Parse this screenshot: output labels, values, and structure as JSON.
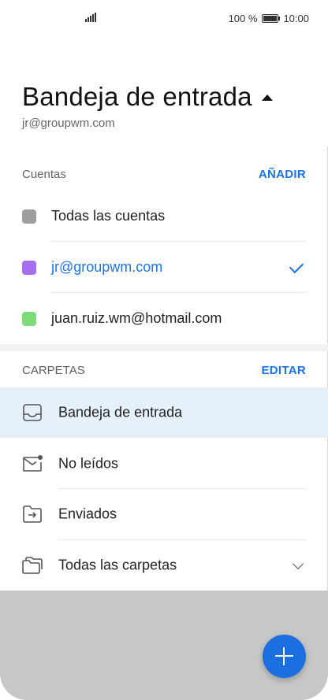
{
  "status": {
    "battery": "100 %",
    "time": "10:00"
  },
  "header": {
    "title": "Bandeja de entrada",
    "subtitle": "jr@groupwm.com"
  },
  "accounts": {
    "label": "Cuentas",
    "add_label": "AÑADIR",
    "items": [
      {
        "name": "Todas las cuentas",
        "color": "#9e9e9e"
      },
      {
        "name": "jr@groupwm.com",
        "color": "#a56ef0",
        "selected": true
      },
      {
        "name": "juan.ruiz.wm@hotmail.com",
        "color": "#7ddb7a"
      }
    ]
  },
  "folders": {
    "label": "CARPETAS",
    "edit_label": "EDITAR",
    "items": [
      {
        "name": "Bandeja de entrada",
        "icon": "inbox-icon",
        "selected": true
      },
      {
        "name": "No leídos",
        "icon": "unread-mail-icon"
      },
      {
        "name": "Enviados",
        "icon": "sent-folder-icon"
      },
      {
        "name": "Todas las carpetas",
        "icon": "folders-icon",
        "expandable": true
      }
    ]
  },
  "fab": {
    "icon": "plus-icon"
  }
}
